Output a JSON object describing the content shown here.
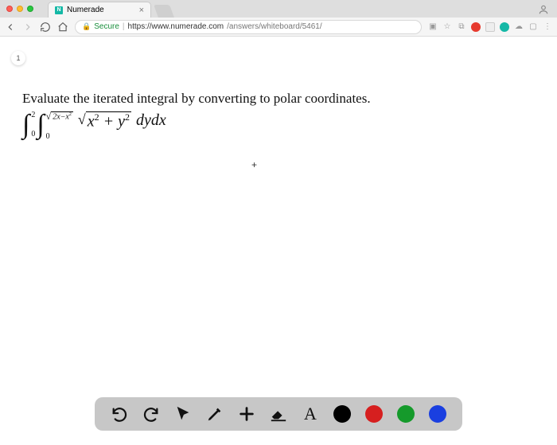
{
  "browser": {
    "tab_title": "Numerade",
    "secure_label": "Secure",
    "url_host": "https://www.numerade.com",
    "url_path": "/answers/whiteboard/5461/"
  },
  "whiteboard": {
    "step_number": "1",
    "problem_text": "Evaluate the iterated integral by converting to polar coordinates.",
    "integral": {
      "outer_lower": "0",
      "outer_upper": "2",
      "inner_lower": "0",
      "inner_upper_radicand": "2x−x",
      "inner_upper_exp": "2",
      "integrand_radicand_a": "x",
      "integrand_radicand_b": "y",
      "integrand_exp": "2",
      "plus": " + ",
      "differential": "dydx"
    },
    "cursor_symbol": "+"
  },
  "toolbar": {
    "colors": {
      "black": "#000000",
      "red": "#d61f1f",
      "green": "#159a2b",
      "blue": "#1a3fe0"
    }
  }
}
